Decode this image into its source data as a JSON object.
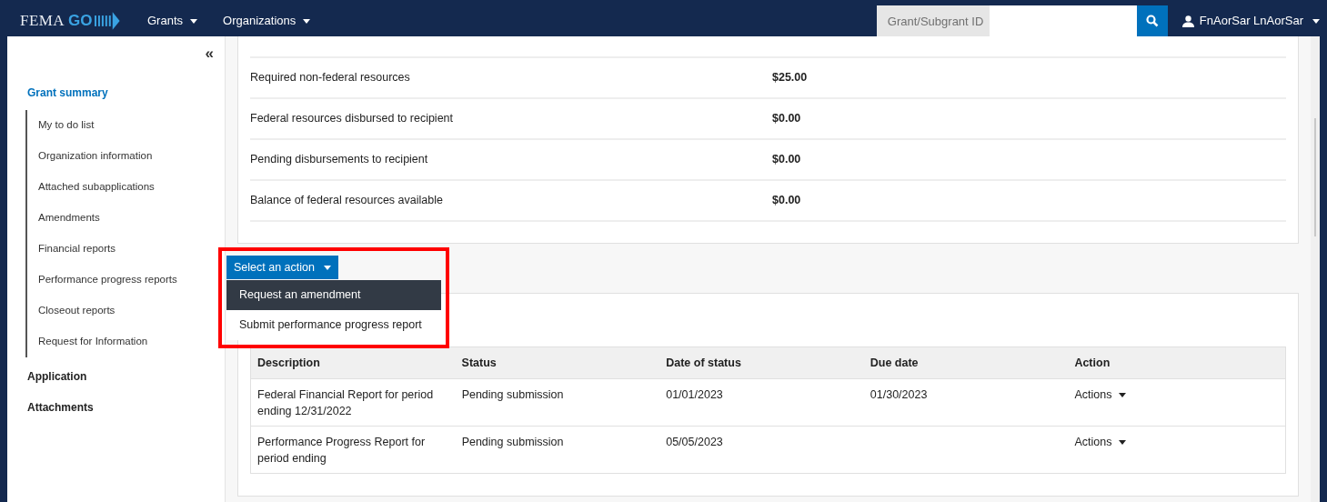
{
  "header": {
    "logo_text": "FEMA",
    "logo_accent": "GO",
    "menus": [
      {
        "label": "Grants"
      },
      {
        "label": "Organizations"
      }
    ],
    "search": {
      "label": "Grant/Subgrant ID"
    },
    "user": {
      "name": "FnAorSar LnAorSar"
    }
  },
  "sidebar": {
    "collapse": "«",
    "items": [
      {
        "label": "Grant summary",
        "selected": true,
        "children": [
          {
            "label": "My to do list",
            "selected": false
          },
          {
            "label": "Organization information",
            "selected": false
          },
          {
            "label": "Attached subapplications",
            "selected": false
          },
          {
            "label": "Amendments",
            "selected": false
          },
          {
            "label": "Financial reports",
            "selected": false
          },
          {
            "label": "Performance progress reports",
            "selected": false
          },
          {
            "label": "Closeout reports",
            "selected": false
          },
          {
            "label": "Request for Information",
            "selected": false
          }
        ]
      },
      {
        "label": "Application",
        "selected": false
      },
      {
        "label": "Attachments",
        "selected": false
      }
    ]
  },
  "resources": [
    {
      "label": "Required non-federal resources",
      "value": "$25.00"
    },
    {
      "label": "Federal resources disbursed to recipient",
      "value": "$0.00"
    },
    {
      "label": "Pending disbursements to recipient",
      "value": "$0.00"
    },
    {
      "label": "Balance of federal resources available",
      "value": "$0.00"
    }
  ],
  "action_menu": {
    "label": "Select an action",
    "expanded": true,
    "highlighted": true,
    "items": [
      {
        "label": "Request an amendment",
        "selected": true
      },
      {
        "label": "Submit performance progress report",
        "selected": false
      }
    ]
  },
  "table": {
    "columns": [
      "Description",
      "Status",
      "Date of status",
      "Due date",
      "Action"
    ],
    "rows": [
      {
        "description": "Federal Financial Report for period ending 12/31/2022",
        "status": "Pending submission",
        "date_of_status": "01/01/2023",
        "due_date": "01/30/2023",
        "action": "Actions"
      },
      {
        "description": "Performance Progress Report for period ending",
        "status": "Pending submission",
        "date_of_status": "05/05/2023",
        "action": "Actions"
      }
    ]
  }
}
